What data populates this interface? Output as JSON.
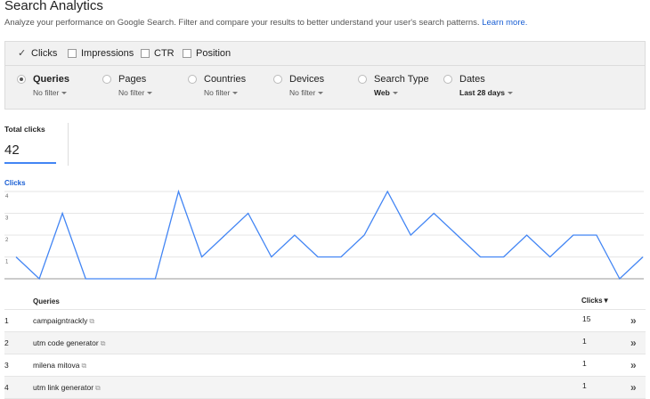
{
  "header": {
    "title": "Search Analytics",
    "subtitle": "Analyze your performance on Google Search. Filter and compare your results to better understand your user's search patterns.",
    "learn_more": "Learn more."
  },
  "metrics": [
    {
      "label": "Clicks",
      "checked": true
    },
    {
      "label": "Impressions",
      "checked": false
    },
    {
      "label": "CTR",
      "checked": false
    },
    {
      "label": "Position",
      "checked": false
    }
  ],
  "dimensions": [
    {
      "label": "Queries",
      "filter": "No filter",
      "selected": true
    },
    {
      "label": "Pages",
      "filter": "No filter",
      "selected": false
    },
    {
      "label": "Countries",
      "filter": "No filter",
      "selected": false
    },
    {
      "label": "Devices",
      "filter": "No filter",
      "selected": false
    },
    {
      "label": "Search Type",
      "filter": "Web",
      "selected": false
    },
    {
      "label": "Dates",
      "filter": "Last 28 days",
      "selected": false
    }
  ],
  "totals": {
    "label": "Total clicks",
    "value": "42"
  },
  "chart_data": {
    "type": "line",
    "title": "Clicks",
    "yticks": [
      "1",
      "2",
      "3",
      "4"
    ],
    "ylim": [
      0,
      4
    ],
    "series": [
      {
        "values": [
          1,
          0,
          3,
          0,
          0,
          0,
          0,
          4,
          1,
          2,
          3,
          1,
          2,
          1,
          1,
          2,
          4,
          2,
          3,
          2,
          1,
          1,
          2,
          1,
          2,
          2,
          0,
          1
        ]
      }
    ],
    "color": "#4285f4",
    "grid": true
  },
  "table": {
    "columns": {
      "query": "Queries",
      "clicks": "Clicks"
    },
    "rows": [
      {
        "num": "1",
        "query": "campaigntrackly",
        "clicks": "15"
      },
      {
        "num": "2",
        "query": "utm code generator",
        "clicks": "1"
      },
      {
        "num": "3",
        "query": "milena mitova",
        "clicks": "1"
      },
      {
        "num": "4",
        "query": "utm link generator",
        "clicks": "1"
      }
    ]
  },
  "icons": {
    "external": "external-link-icon",
    "row_arrow": "chevron-double-right-icon",
    "sort": "sort-desc-icon"
  }
}
